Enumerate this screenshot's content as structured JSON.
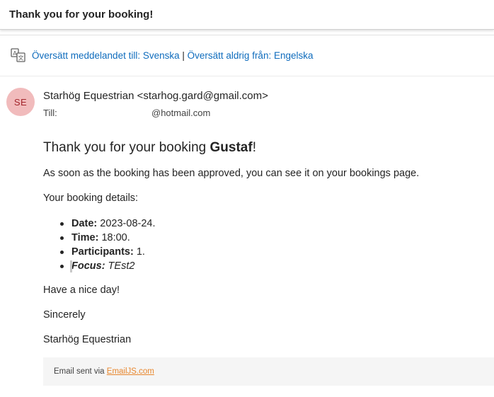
{
  "email": {
    "subject": "Thank you for your booking!",
    "translate": {
      "icon": "translate-icon",
      "translate_to": "Översätt meddelandet till: Svenska",
      "separator": "|",
      "never_translate": "Översätt aldrig från: Engelska"
    },
    "sender": {
      "initials": "SE",
      "display": "Starhög Equestrian <starhog.gard@gmail.com>",
      "avatar_bg": "#f1bbbc",
      "avatar_fg": "#a4262c"
    },
    "recipient": {
      "label": "Till:",
      "address_visible": "@hotmail.com"
    },
    "body": {
      "greeting_prefix": "Thank you for your booking ",
      "greeting_name": "Gustaf",
      "greeting_suffix": "!",
      "approval_text": "As soon as the booking has been approved, you can see it on your bookings page.",
      "details_heading": "Your booking details:",
      "details": [
        {
          "label": "Date:",
          "value": " 2023-08-24."
        },
        {
          "label": "Time:",
          "value": " 18:00."
        },
        {
          "label": "Participants:",
          "value": " 1."
        },
        {
          "label": "Focus:",
          "value": " TEst2"
        }
      ],
      "closing": "Have a nice day!",
      "signoff": "Sincerely",
      "signature": "Starhög Equestrian"
    },
    "footer": {
      "prefix": "Email sent via ",
      "link": "EmailJS.com",
      "link_color": "#e8862d"
    },
    "accent_color": "#0f6cbd"
  }
}
